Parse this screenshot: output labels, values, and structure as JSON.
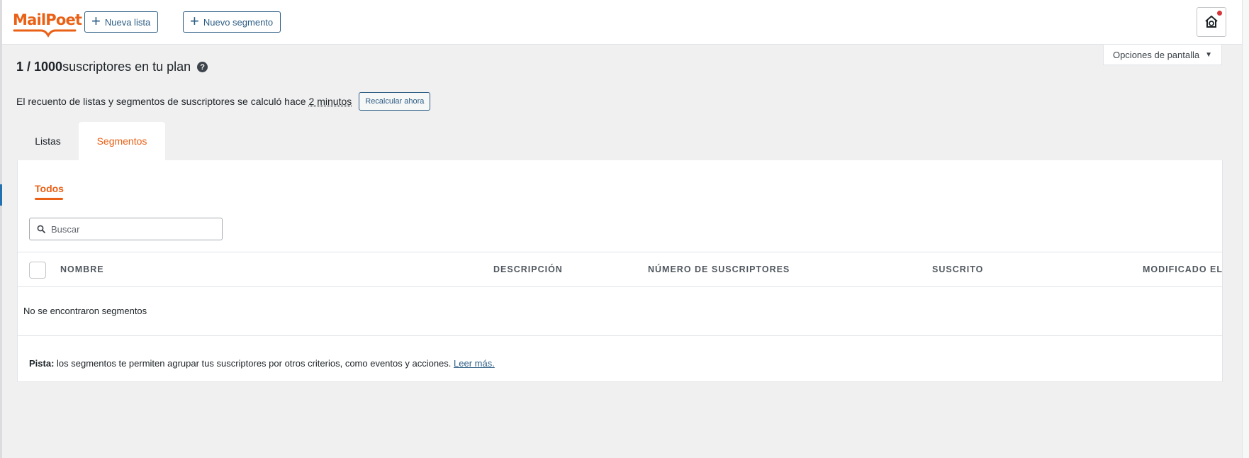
{
  "brand": {
    "name": "MailPoet",
    "color": "#ea6015"
  },
  "header": {
    "new_list_label": "Nueva lista",
    "new_segment_label": "Nuevo segmento",
    "help_icon": "help-home-icon"
  },
  "screen_options": {
    "label": "Opciones de pantalla"
  },
  "plan": {
    "count": "1 / 1000",
    "suffix": "suscriptores en tu plan"
  },
  "recount": {
    "text": "El recuento de listas y segmentos de suscriptores se calculó hace",
    "ago": "2 minutos",
    "button_label": "Recalcular ahora"
  },
  "tabs": [
    {
      "label": "Listas",
      "active": false
    },
    {
      "label": "Segmentos",
      "active": true
    }
  ],
  "filters": {
    "active": "Todos"
  },
  "search": {
    "placeholder": "Buscar",
    "value": ""
  },
  "table": {
    "columns": [
      "NOMBRE",
      "DESCRIPCIÓN",
      "NÚMERO DE SUSCRIPTORES",
      "SUSCRITO",
      "MODIFICADO EL"
    ],
    "empty_message": "No se encontraron segmentos"
  },
  "hint": {
    "label": "Pista:",
    "text": "los segmentos te permiten agrupar tus suscriptores por otros criterios, como eventos y acciones.",
    "link": "Leer más."
  }
}
